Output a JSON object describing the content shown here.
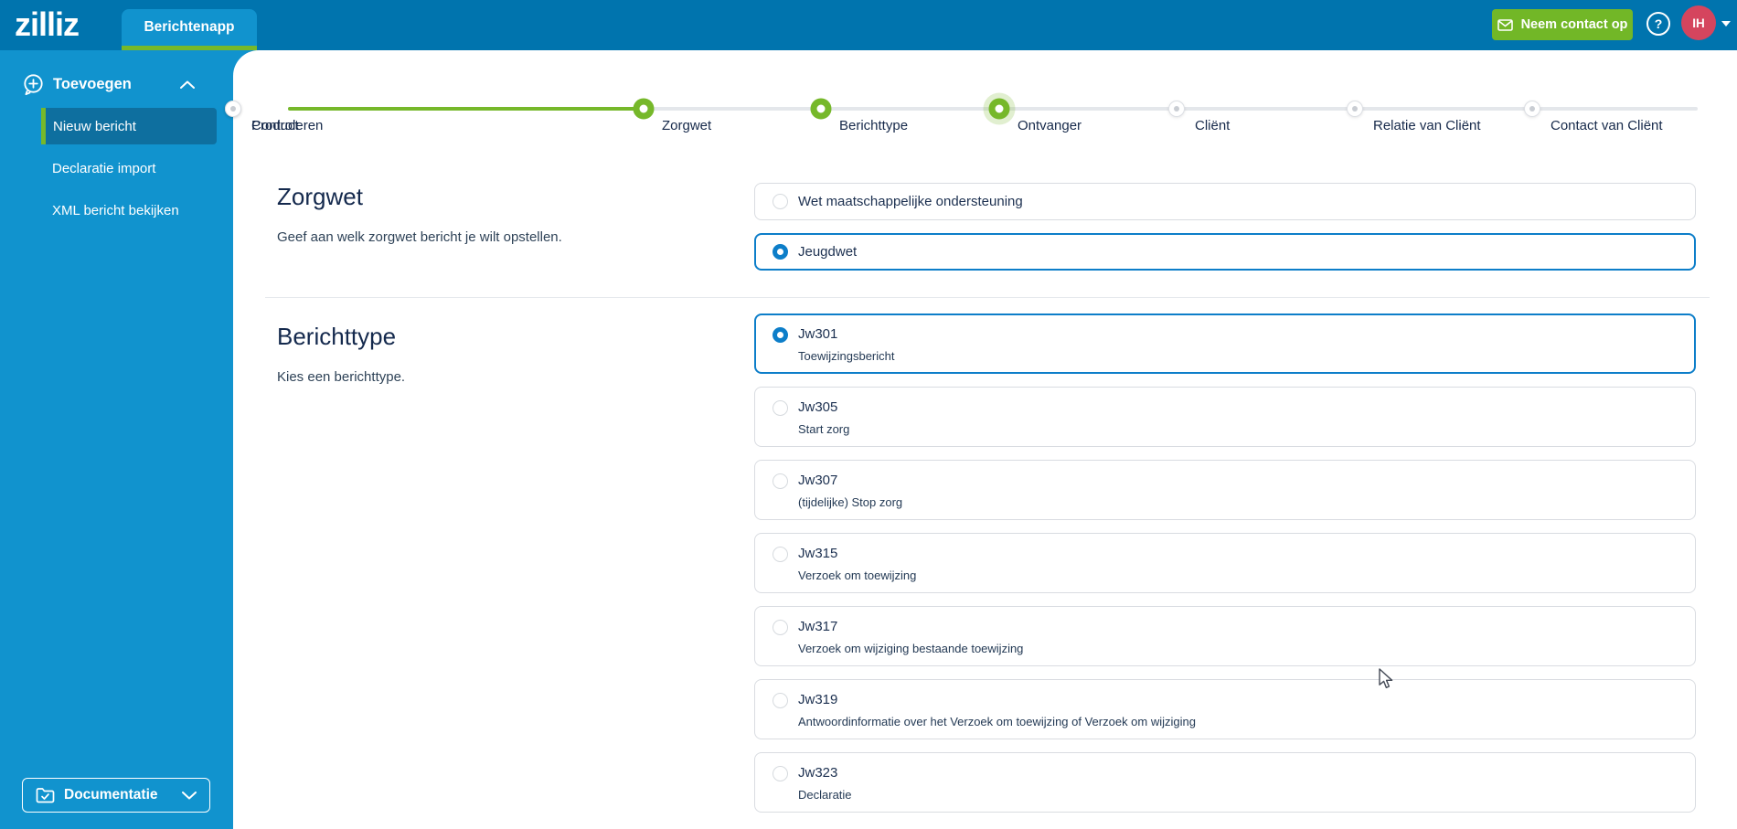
{
  "header": {
    "logo": "zilliz",
    "tab": "Berichtenapp",
    "contact_button": "Neem contact op",
    "avatar_initials": "IH"
  },
  "sidebar": {
    "group_label": "Toevoegen",
    "items": [
      {
        "label": "Nieuw bericht",
        "active": true
      },
      {
        "label": "Declaratie import",
        "active": false
      },
      {
        "label": "XML bericht bekijken",
        "active": false
      }
    ],
    "documentation_label": "Documentatie"
  },
  "stepper": {
    "steps": [
      {
        "label": "Zorgwet",
        "state": "complete"
      },
      {
        "label": "Berichttype",
        "state": "complete"
      },
      {
        "label": "Ontvanger",
        "state": "current"
      },
      {
        "label": "Cliënt",
        "state": "future"
      },
      {
        "label": "Relatie van Cliënt",
        "state": "future"
      },
      {
        "label": "Contact van Cliënt",
        "state": "future"
      },
      {
        "label": "Product",
        "state": "future"
      },
      {
        "label": "Controleren",
        "state": "future"
      }
    ]
  },
  "sections": [
    {
      "title": "Zorgwet",
      "description": "Geef aan welk zorgwet bericht je wilt opstellen.",
      "options": [
        {
          "label": "Wet maatschappelijke ondersteuning",
          "selected": false
        },
        {
          "label": "Jeugdwet",
          "selected": true
        }
      ]
    },
    {
      "title": "Berichttype",
      "description": "Kies een berichttype.",
      "options": [
        {
          "label": "Jw301",
          "sublabel": "Toewijzingsbericht",
          "selected": true
        },
        {
          "label": "Jw305",
          "sublabel": "Start zorg",
          "selected": false
        },
        {
          "label": "Jw307",
          "sublabel": "(tijdelijke) Stop zorg",
          "selected": false
        },
        {
          "label": "Jw315",
          "sublabel": "Verzoek om toewijzing",
          "selected": false
        },
        {
          "label": "Jw317",
          "sublabel": "Verzoek om wijziging bestaande toewijzing",
          "selected": false
        },
        {
          "label": "Jw319",
          "sublabel": "Antwoordinformatie over het Verzoek om toewijzing of Verzoek om wijziging",
          "selected": false
        },
        {
          "label": "Jw323",
          "sublabel": "Declaratie",
          "selected": false
        }
      ]
    }
  ],
  "colors": {
    "brand_green": "#76b82a",
    "topbar_blue": "#0074ae",
    "sidebar_blue": "#1193ce",
    "active_item_blue": "#0e6f9f",
    "selected_blue": "#0d7ec9",
    "avatar_red": "#d5455e",
    "heading_navy": "#14294d"
  }
}
